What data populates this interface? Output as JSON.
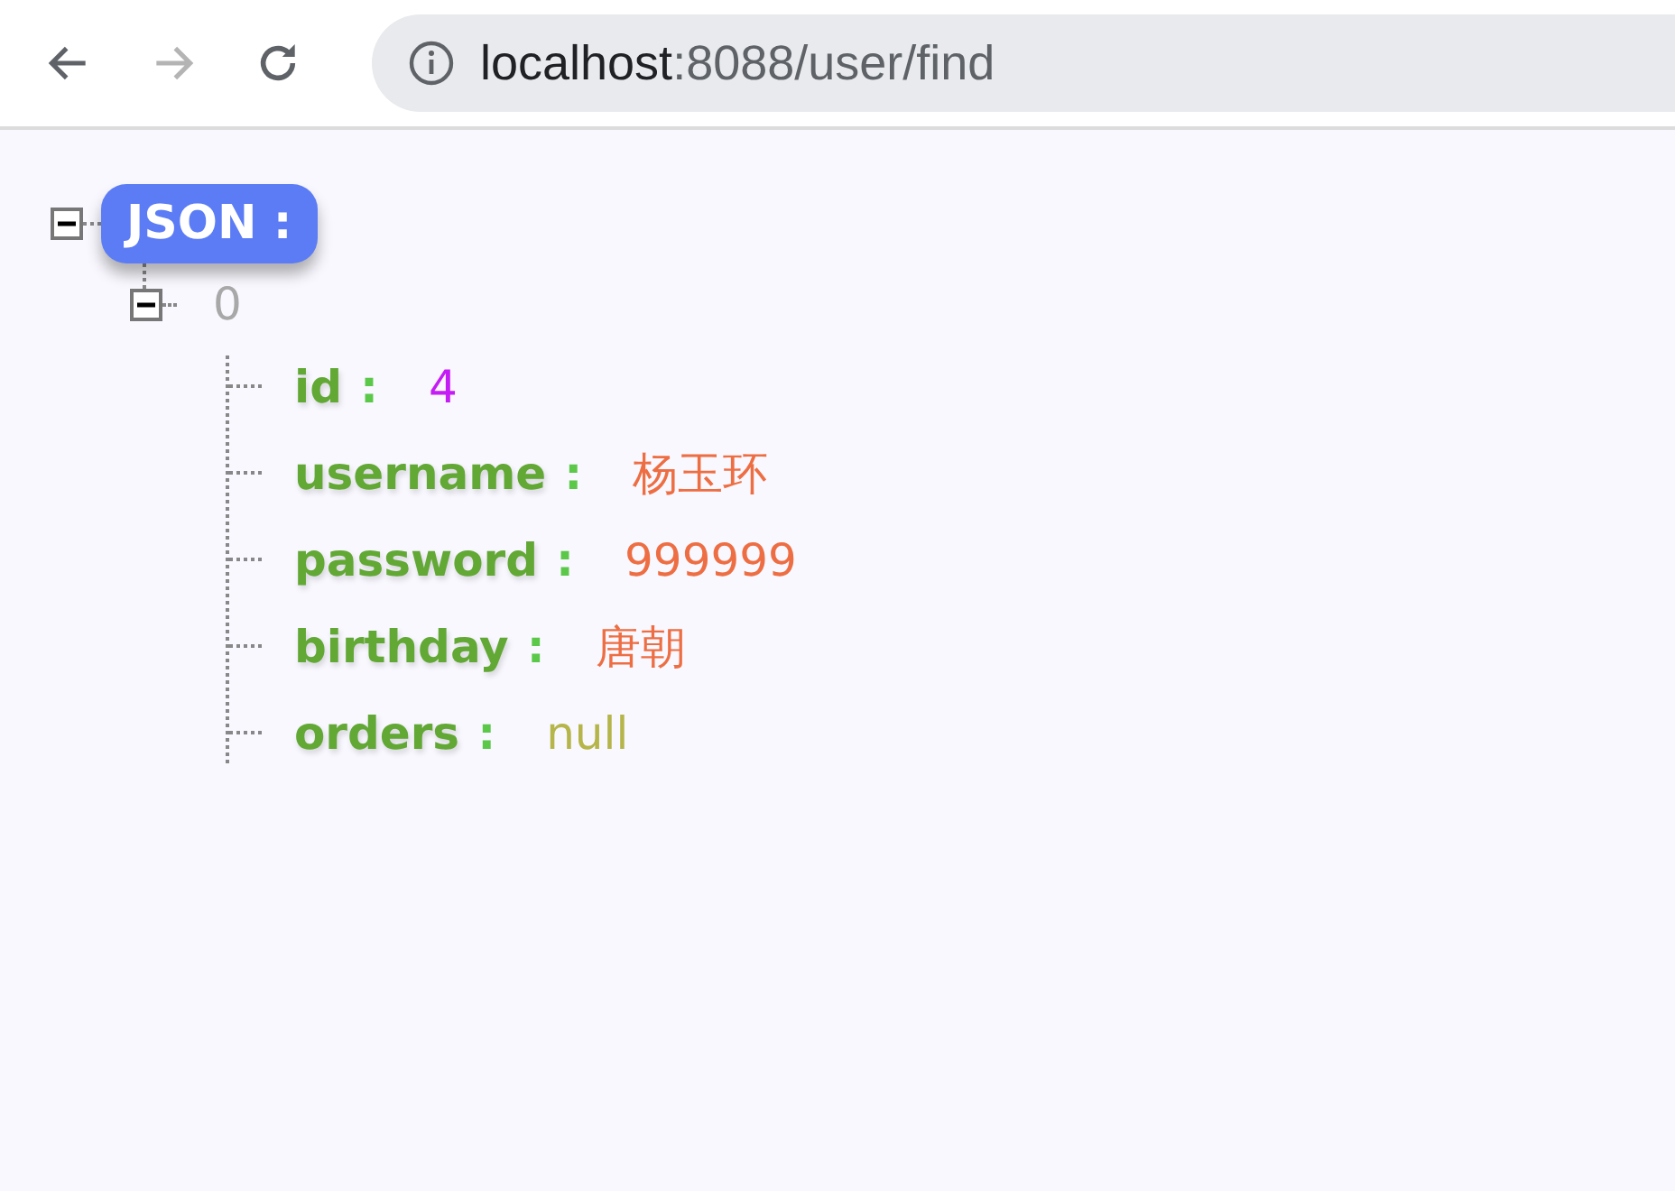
{
  "browser": {
    "url_host": "localhost",
    "url_path": ":8088/user/find"
  },
  "tree": {
    "label": "JSON :",
    "expanded": true,
    "children": [
      {
        "label": "0",
        "expanded": true,
        "fields": [
          {
            "key": "id",
            "colon": ":",
            "value": "4",
            "kind": "number"
          },
          {
            "key": "username",
            "colon": ":",
            "value": "杨玉环",
            "kind": "string"
          },
          {
            "key": "password",
            "colon": ":",
            "value": "999999",
            "kind": "string"
          },
          {
            "key": "birthday",
            "colon": ":",
            "value": "唐朝",
            "kind": "string"
          },
          {
            "key": "orders",
            "colon": ":",
            "value": "null",
            "kind": "null"
          }
        ]
      }
    ]
  }
}
